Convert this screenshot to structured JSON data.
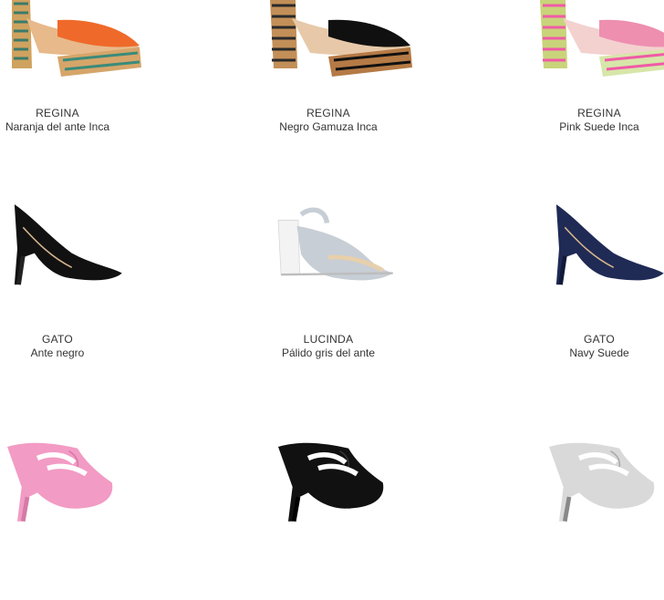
{
  "products": [
    {
      "name": "REGINA",
      "color": "Naranja del ante Inca",
      "upper": "#ef6a2a",
      "icon": "platform-sandal-icon"
    },
    {
      "name": "REGINA",
      "color": "Negro Gamuza Inca",
      "upper": "#101010",
      "icon": "platform-sandal-icon"
    },
    {
      "name": "REGINA",
      "color": "Pink Suede Inca",
      "upper": "#ee8fb0",
      "icon": "platform-sandal-icon"
    },
    {
      "name": "GATO",
      "color": "Ante negro",
      "upper": "#111111",
      "icon": "pump-icon"
    },
    {
      "name": "LUCINDA",
      "color": "Pálido gris del ante",
      "upper": "#c8ced6",
      "icon": "slingback-icon"
    },
    {
      "name": "GATO",
      "color": "Navy Suede",
      "upper": "#1f2a55",
      "icon": "pump-icon"
    },
    {
      "name": "",
      "color": "",
      "upper": "#f29bc4",
      "icon": "cutout-sandal-icon"
    },
    {
      "name": "",
      "color": "",
      "upper": "#111111",
      "icon": "cutout-sandal-icon"
    },
    {
      "name": "",
      "color": "",
      "upper": "#d9d9d9",
      "icon": "cutout-sandal-icon"
    }
  ]
}
